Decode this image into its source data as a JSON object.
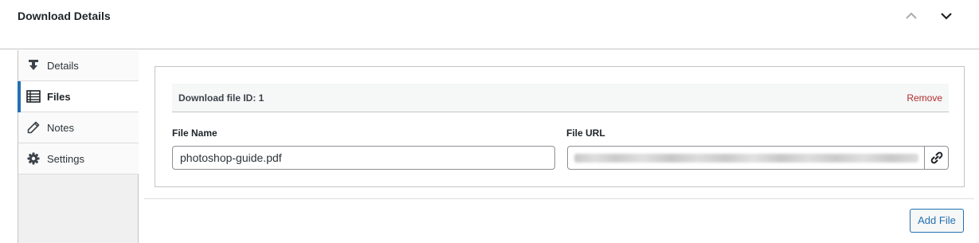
{
  "metabox": {
    "title": "Download Details"
  },
  "tabs": [
    {
      "label": "Details",
      "icon": "download-icon",
      "active": false
    },
    {
      "label": "Files",
      "icon": "list-icon",
      "active": true
    },
    {
      "label": "Notes",
      "icon": "pencil-icon",
      "active": false
    },
    {
      "label": "Settings",
      "icon": "gear-icon",
      "active": false
    }
  ],
  "file": {
    "id_label": "Download file ID: 1",
    "remove_label": "Remove",
    "name_label": "File Name",
    "name_value": "photoshop-guide.pdf",
    "url_label": "File URL"
  },
  "footer": {
    "add_file_label": "Add File"
  },
  "colors": {
    "accent": "#2271b1",
    "danger": "#b32d2e",
    "tab_bg": "#f0f0f1"
  }
}
